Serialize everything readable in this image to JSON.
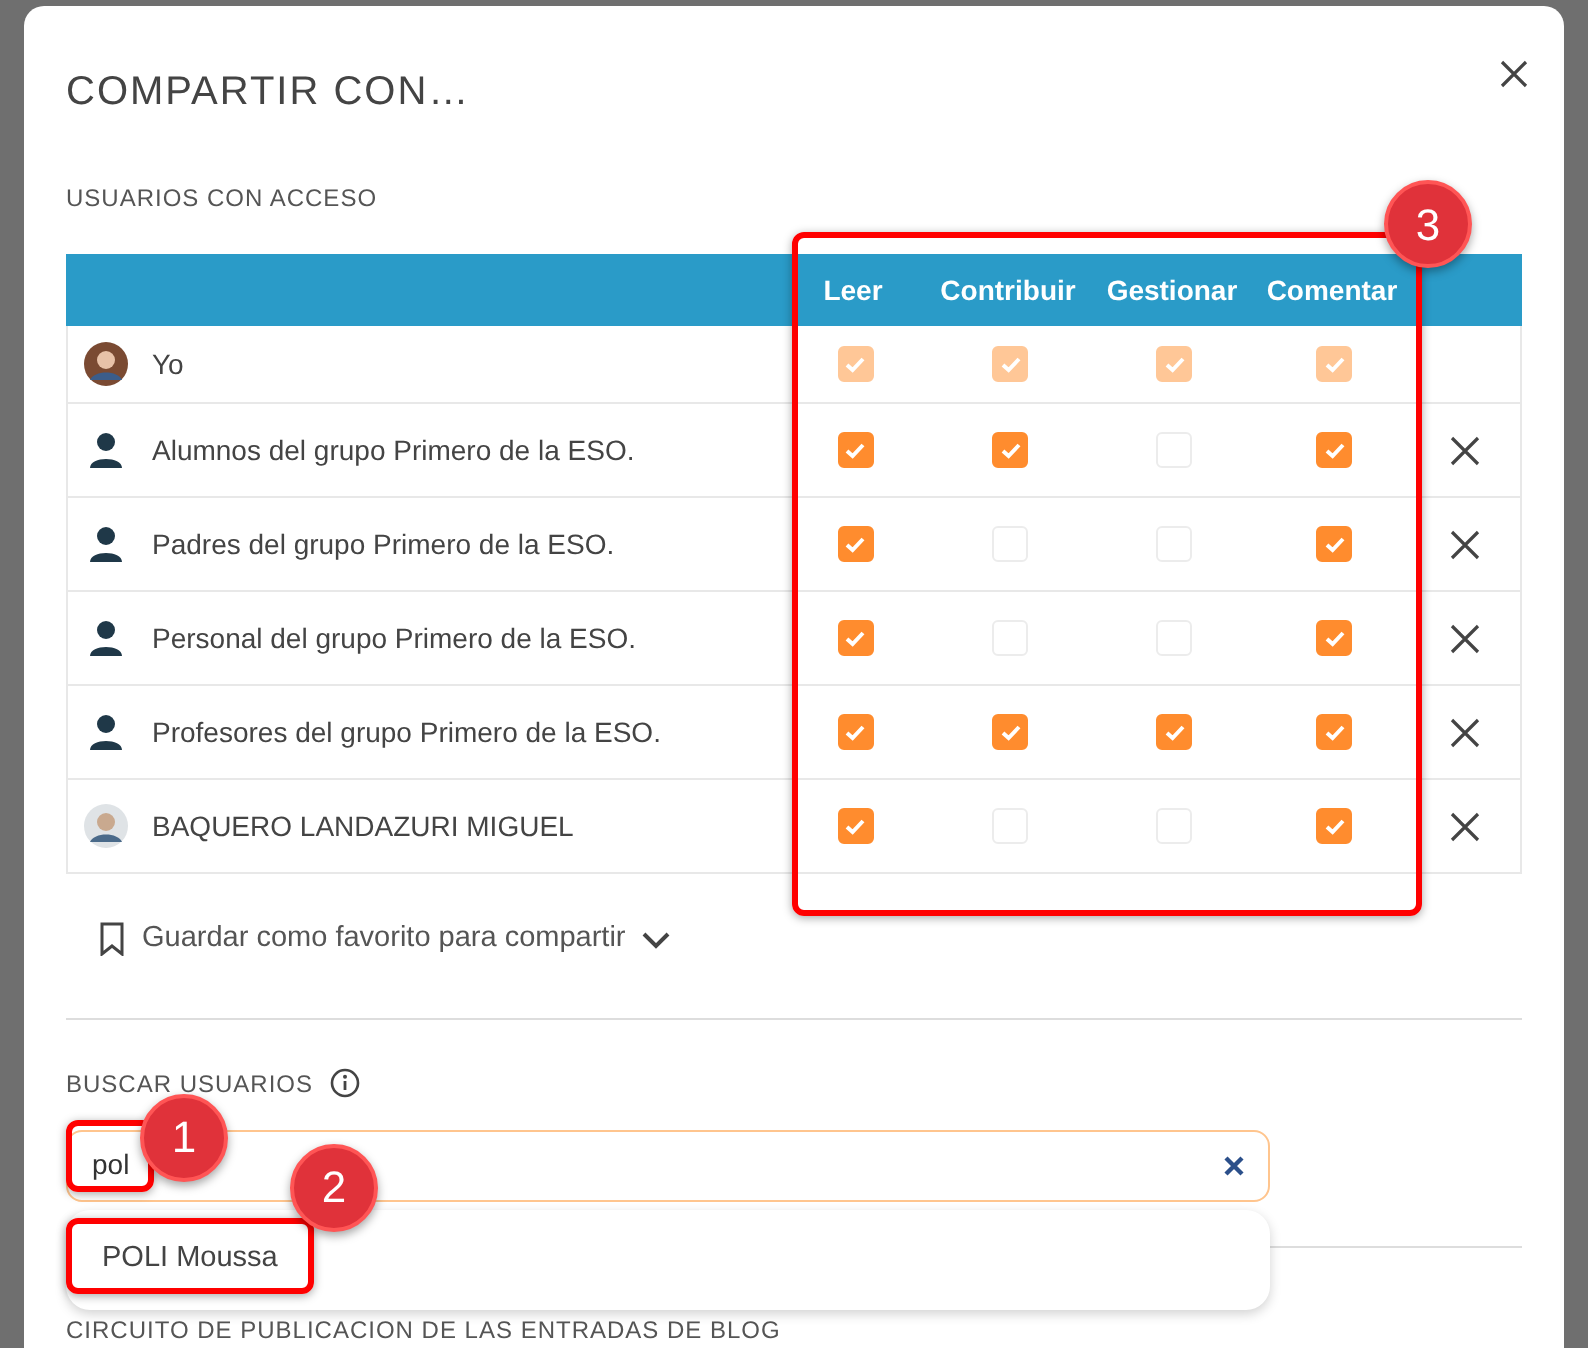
{
  "dialog": {
    "title": "COMPARTIR CON…"
  },
  "access": {
    "label": "USUARIOS CON ACCESO",
    "callout": "3",
    "columns": [
      "Leer",
      "Contribuir",
      "Gestionar",
      "Comentar"
    ],
    "rows": [
      {
        "name": "Yo",
        "kind": "photo",
        "disabled": true,
        "removable": false,
        "permissions": [
          true,
          true,
          true,
          true
        ]
      },
      {
        "name": "Alumnos del grupo Primero de la ESO.",
        "kind": "group",
        "disabled": false,
        "removable": true,
        "permissions": [
          true,
          true,
          false,
          true
        ]
      },
      {
        "name": "Padres del grupo Primero de la ESO.",
        "kind": "group",
        "disabled": false,
        "removable": true,
        "permissions": [
          true,
          false,
          false,
          true
        ]
      },
      {
        "name": "Personal del grupo Primero de la ESO.",
        "kind": "group",
        "disabled": false,
        "removable": true,
        "permissions": [
          true,
          false,
          false,
          true
        ]
      },
      {
        "name": "Profesores del grupo Primero de la ESO.",
        "kind": "group",
        "disabled": false,
        "removable": true,
        "permissions": [
          true,
          true,
          true,
          true
        ]
      },
      {
        "name": "BAQUERO LANDAZURI MIGUEL",
        "kind": "photo",
        "disabled": false,
        "removable": true,
        "permissions": [
          true,
          false,
          false,
          true
        ]
      }
    ]
  },
  "favorite": {
    "label": "Guardar como favorito para compartir",
    "expanded": false
  },
  "search": {
    "label": "BUSCAR USUARIOS",
    "value": "pol",
    "callout": "1",
    "suggestions": [
      {
        "label": "POLI Moussa",
        "callout": "2"
      }
    ]
  },
  "next_section": {
    "label": "CIRCUITO DE PUBLICACION DE LAS ENTRADAS DE BLOG"
  }
}
